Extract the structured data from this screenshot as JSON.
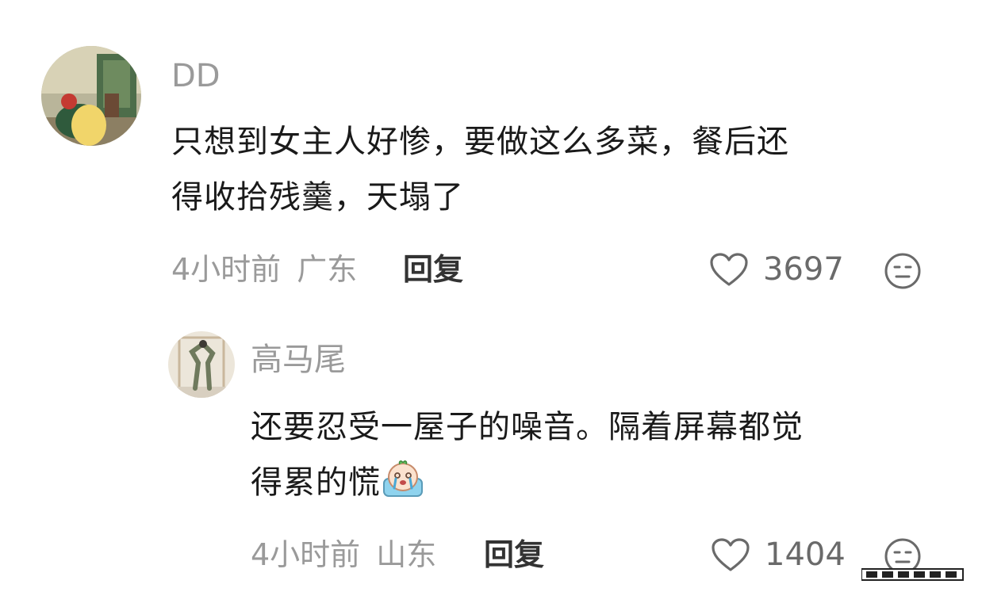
{
  "comments": [
    {
      "username": "DD",
      "text_lines": [
        "只想到女主人好惨，要做这么多菜，餐后还",
        "得收拾残羹，天塌了"
      ],
      "time": "4小时前",
      "location": "广东",
      "reply_label": "回复",
      "likes": "3697",
      "like_icon": "heart-outline-icon",
      "react_icon": "expressionless-face-icon"
    },
    {
      "username": "高马尾",
      "text_lines": [
        "还要忍受一屋子的噪音。隔着屏幕都觉",
        "得累的慌"
      ],
      "inline_emoji": "crying-emoji",
      "time": "4小时前",
      "location": "山东",
      "reply_label": "回复",
      "likes": "1404",
      "like_icon": "heart-outline-icon",
      "react_icon": "expressionless-face-icon"
    }
  ],
  "colors": {
    "meta": "#9a9a9a",
    "text": "#1a1a1a",
    "reply": "#333333",
    "icon": "#6a6a6a"
  }
}
